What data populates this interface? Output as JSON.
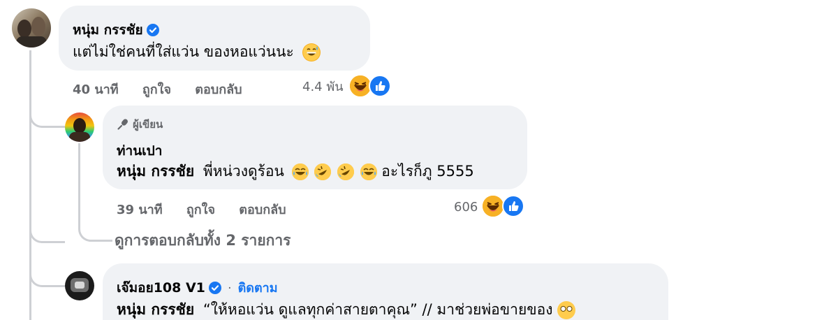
{
  "comments": [
    {
      "author": "หนุ่ม กรรชัย",
      "text": "แต่ไม่ใช่คนที่ใส่แว่น ของหอแว่นนะ",
      "time": "40 นาที",
      "like_label": "ถูกใจ",
      "reply_label": "ตอบกลับ",
      "reaction_count": "4.4 พัน"
    }
  ],
  "replies": [
    {
      "badge": "ผู้เขียน",
      "author": "ท่านเปา",
      "mention": "หนุ่ม กรรชัย",
      "text_before": "พี่หน่วงดูร้อน",
      "text_after": "อะไรก็ภู 5555",
      "time": "39 นาที",
      "like_label": "ถูกใจ",
      "reply_label": "ตอบกลับ",
      "reaction_count": "606"
    },
    {
      "author": "เจ๊มอย108 V1",
      "separator": "·",
      "follow_label": "ติดตาม",
      "mention": "หนุ่ม กรรชัย",
      "text": "“ให้หอแว่น ดูแลทุกค่าสายตาคุณ” // มาช่วยพ่อขายของ"
    }
  ],
  "view_replies": "ดูการตอบกลับทั้ง 2 รายการ",
  "colors": {
    "bubble": "#f0f2f5",
    "meta": "#65676b",
    "link": "#1877f2",
    "reaction_yellow": "#f7b125"
  }
}
